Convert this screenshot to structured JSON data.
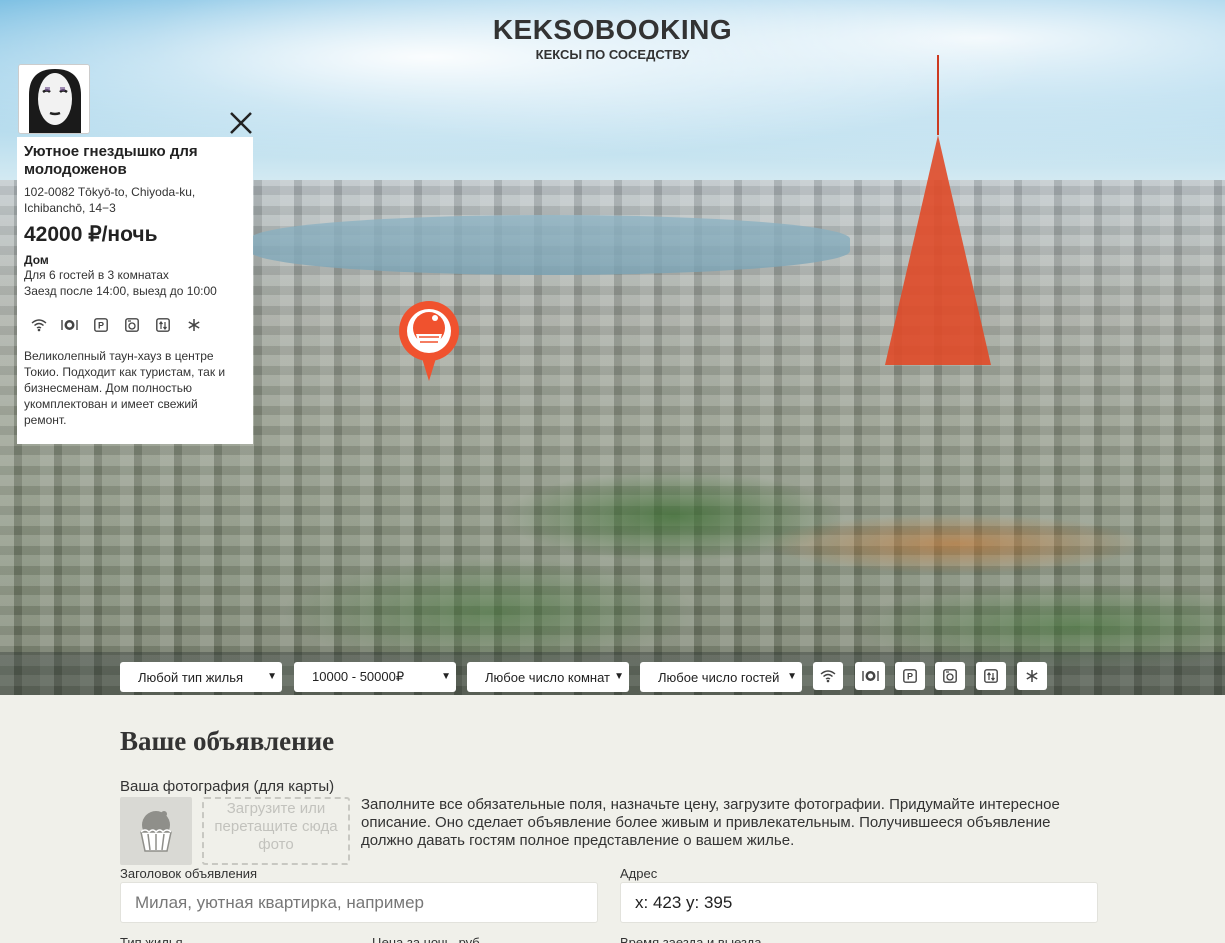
{
  "header": {
    "title": "KEKSOBOOKING",
    "subtitle": "КЕКСЫ ПО СОСЕДСТВУ"
  },
  "card": {
    "title": "Уютное гнездышко для молодоженов",
    "address": "102-0082 Tōkyō-to, Chiyoda-ku, Ichibanchō, 14−3",
    "price": "42000 ₽/ночь",
    "type": "Дом",
    "capacity": "Для 6 гостей в 3 комнатах",
    "time": "Заезд после 14:00, выезд до 10:00",
    "features": [
      "wifi-icon",
      "dishwasher-icon",
      "parking-icon",
      "washer-icon",
      "elevator-icon",
      "conditioner-icon"
    ],
    "description": "Великолепный таун-хауз в центре Токио. Подходит как туристам, так и бизнесменам. Дом полностью укомплектован и имеет свежий ремонт."
  },
  "filters": {
    "housing_type": "Любой тип жилья",
    "price": "10000 - 50000₽",
    "rooms": "Любое число комнат",
    "guests": "Любое число гостей",
    "features": [
      "wifi-icon",
      "dishwasher-icon",
      "parking-icon",
      "washer-icon",
      "elevator-icon",
      "conditioner-icon"
    ]
  },
  "form": {
    "title": "Ваше объявление",
    "photo_label": "Ваша фотография (для карты)",
    "drop_text": "Загрузите или перетащите сюда фото",
    "hint": "Заполните все обязательные поля, назначьте цену, загрузите фотографии. Придумайте интересное описание. Оно сделает объявление более живым и привлекательным. Получившееся объявление должно давать гостям полное представление о вашем жилье.",
    "title_label": "Заголовок объявления",
    "title_placeholder": "Милая, уютная квартирка, например",
    "address_label": "Адрес",
    "address_value": "x: 423 y: 395",
    "type_label": "Тип жилья",
    "price_label": "Цена за ночь, руб.",
    "time_label": "Время заезда и выезда"
  },
  "colors": {
    "pin": "#f0522e",
    "page_bg": "#f0f0ea"
  }
}
